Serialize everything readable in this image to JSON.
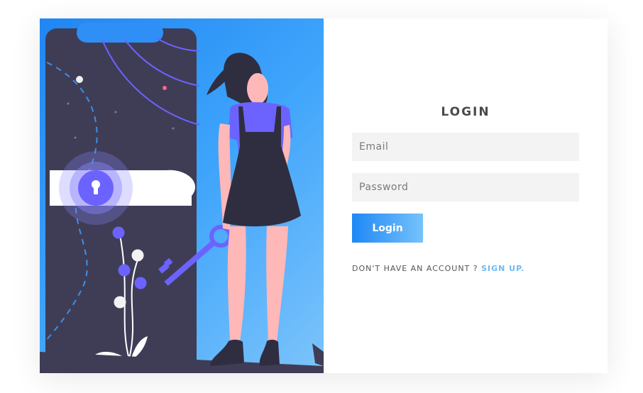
{
  "login": {
    "title": "LOGIN",
    "email_placeholder": "Email",
    "password_placeholder": "Password",
    "button_label": "Login",
    "signup_prompt": "DON'T HAVE AN ACCOUNT ? ",
    "signup_link": "SIGN UP."
  },
  "colors": {
    "accent": "#1e88f5",
    "link": "#6fb8f0",
    "phone": "#3f3d56",
    "purple": "#6c63ff",
    "skin": "#ffb8b8"
  },
  "illustration": {
    "icons": [
      "keyhole-icon",
      "key-icon"
    ]
  }
}
